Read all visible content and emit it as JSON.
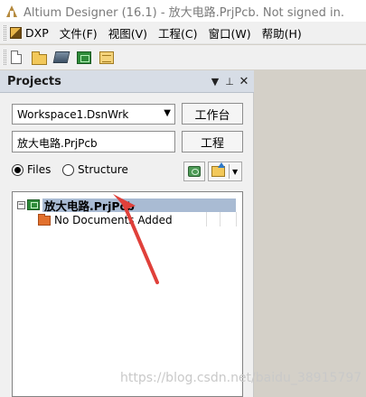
{
  "window": {
    "title": "Altium Designer (16.1) - 放大电路.PrjPcb. Not signed in."
  },
  "menu": {
    "items": [
      "DXP",
      "文件(F)",
      "视图(V)",
      "工程(C)",
      "窗口(W)",
      "帮助(H)"
    ]
  },
  "toolbar": {
    "icons": [
      "new-document-icon",
      "open-folder-icon",
      "chip-icon",
      "pcb-icon",
      "library-icon"
    ]
  },
  "panel": {
    "title": "Projects",
    "workspace_value": "Workspace1.DsnWrk",
    "workbench_button": "工作台",
    "project_value": "放大电路.PrjPcb",
    "project_button": "工程",
    "radio_files": "Files",
    "radio_structure": "Structure",
    "selected_view": "Files"
  },
  "tree": {
    "project_name": "放大电路.PrjPcb",
    "expander": "⊟",
    "child_text": "No Documents Added"
  },
  "watermark": "https://blog.csdn.net/baidu_38915797",
  "colors": {
    "selection": "#a9bbd3",
    "panel_header": "#d7dde6",
    "arrow": "#e0403a"
  }
}
